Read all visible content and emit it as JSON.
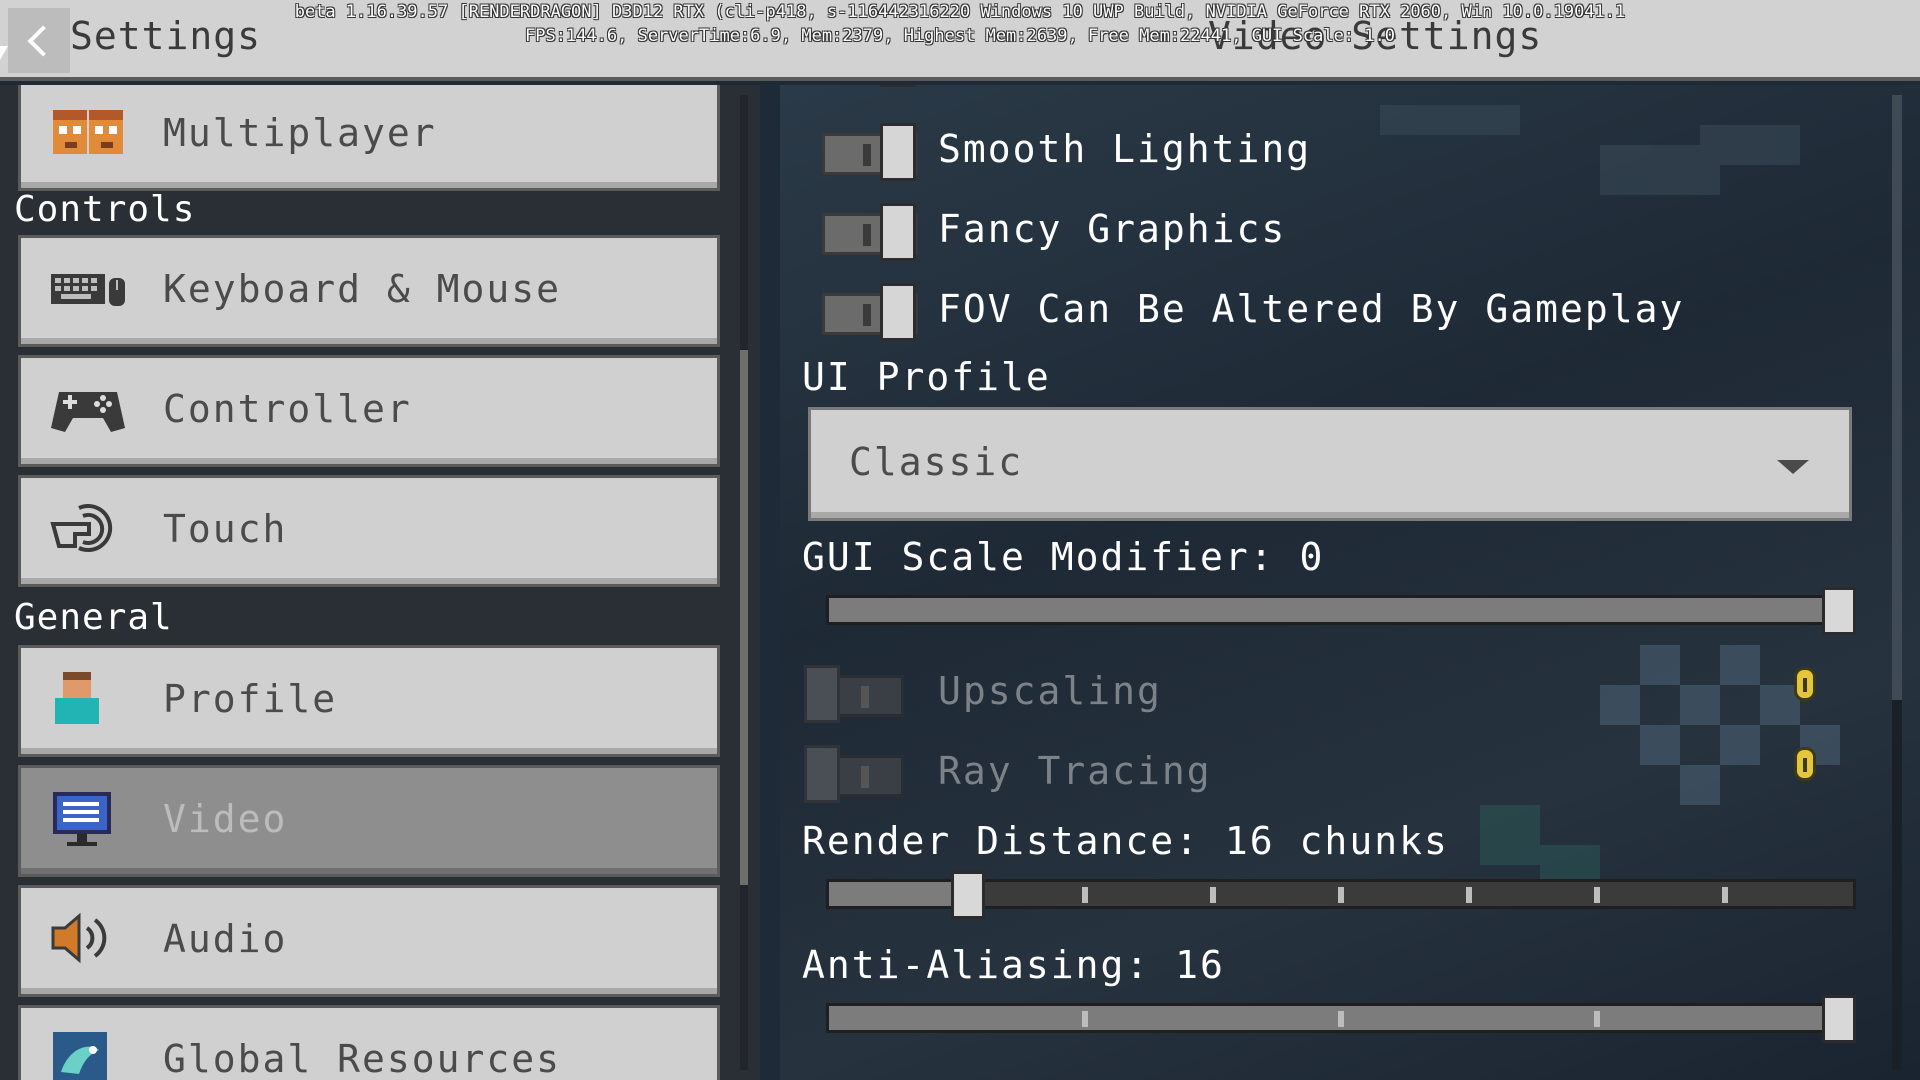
{
  "header": {
    "back_label": "Settings",
    "page_title": "Video Settings",
    "debug_line1": "beta 1.16.39.57 [RENDERDRAGON] D3D12 RTX  (cli-p418, s-116442316220 Windows 10 UWP Build, NVIDIA GeForce RTX 2060, Win 10.0.19041.1",
    "debug_line2": "FPS:144.6, ServerTime:6.9, Mem:2379, Highest Mem:2639, Free Mem:22441, GUI Scale: 1.0"
  },
  "sidebar": {
    "items": [
      {
        "label": "Multiplayer",
        "icon": "multiplayer-icon"
      },
      {
        "label": "Keyboard & Mouse",
        "icon": "keyboard-mouse-icon"
      },
      {
        "label": "Controller",
        "icon": "controller-icon"
      },
      {
        "label": "Touch",
        "icon": "touch-icon"
      },
      {
        "label": "Profile",
        "icon": "profile-icon"
      },
      {
        "label": "Video",
        "icon": "video-icon",
        "active": true
      },
      {
        "label": "Audio",
        "icon": "audio-icon"
      },
      {
        "label": "Global Resources",
        "icon": "global-resources-icon"
      }
    ],
    "sections": {
      "controls": "Controls",
      "general": "General"
    }
  },
  "video": {
    "smooth_lighting": {
      "label": "Smooth Lighting",
      "on": true
    },
    "fancy_graphics": {
      "label": "Fancy Graphics",
      "on": true
    },
    "fov_gameplay": {
      "label": "FOV Can Be Altered By Gameplay",
      "on": true
    },
    "ui_profile": {
      "label": "UI Profile",
      "value": "Classic"
    },
    "gui_scale": {
      "label": "GUI Scale Modifier: 0",
      "value": 0,
      "fraction": 1.0
    },
    "upscaling": {
      "label": "Upscaling",
      "on": false,
      "enabled": false
    },
    "ray_tracing": {
      "label": "Ray Tracing",
      "on": false,
      "enabled": false
    },
    "render_distance": {
      "label": "Render Distance: 16 chunks",
      "value": 16,
      "fraction": 0.125
    },
    "anti_aliasing": {
      "label": "Anti-Aliasing: 16",
      "value": 16,
      "fraction": 1.0
    }
  },
  "colors": {
    "button_bg": "#d0d0d0",
    "active_bg": "#8e8e8e",
    "info_yellow": "#e5c63a"
  }
}
